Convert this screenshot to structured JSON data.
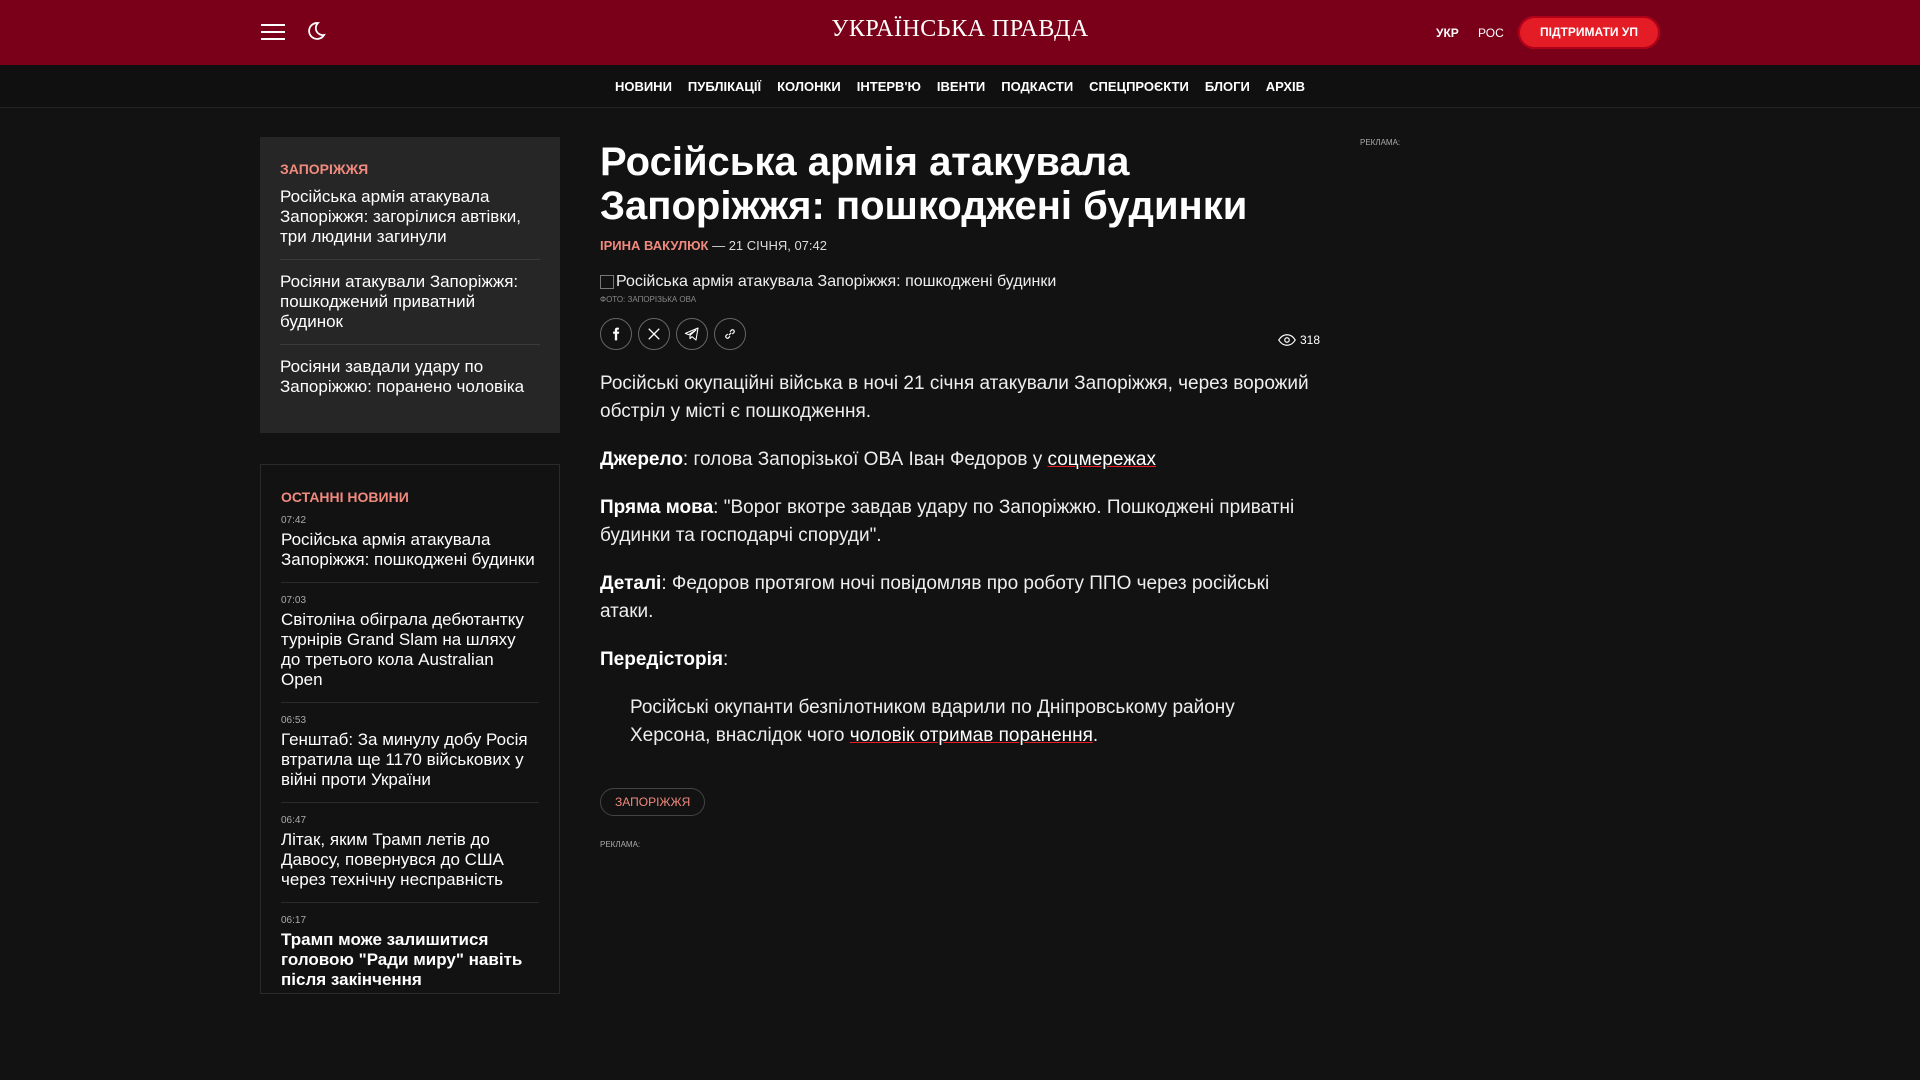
{
  "header": {
    "logo": "УКРАЇНСЬКА ПРАВДА",
    "lang_ukr": "УКР",
    "lang_ros": "РОС",
    "support_label": "ПІДТРИМАТИ УП"
  },
  "nav": [
    "НОВИНИ",
    "ПУБЛІКАЦІЇ",
    "КОЛОНКИ",
    "ІНТЕРВ'Ю",
    "ІВЕНТИ",
    "ПОДКАСТИ",
    "СПЕЦПРОЄКТИ",
    "БЛОГИ",
    "АРХІВ"
  ],
  "sidebar_related": {
    "title": "ЗАПОРІЖЖЯ",
    "items": [
      "Російська армія атакувала Запоріжжя: загорілися автівки, три людини загинули",
      "Росіяни атакували Запоріжжя: пошкоджений приватний будинок",
      "Росіяни завдали удару по Запоріжжю: поранено чоловіка"
    ]
  },
  "sidebar_latest": {
    "title": "ОСТАННІ НОВИНИ",
    "items": [
      {
        "time": "07:42",
        "title": "Російська армія атакувала Запоріжжя: пошкоджені будинки"
      },
      {
        "time": "07:03",
        "title": "Світоліна обіграла дебютантку турнірів Grand Slam на шляху до третього кола Australian Open"
      },
      {
        "time": "06:53",
        "title": "Генштаб: За минулу добу Росія втратила ще 1170 військових у війні проти України"
      },
      {
        "time": "06:47",
        "title": "Літак, яким Трамп летів до Давосу, повернувся до США через технічну несправність"
      },
      {
        "time": "06:17",
        "title": "Трамп може залишитися головою \"Ради миру\" навіть після закінчення"
      }
    ]
  },
  "article": {
    "title": "Російська армія атакувала Запоріжжя: пошкоджені будинки",
    "author": "ІРИНА ВАКУЛЮК",
    "date": "— 21 СІЧНЯ, 07:42",
    "image_alt": "Російська армія атакувала Запоріжжя: пошкоджені будинки",
    "photo_credit": "ФОТО: ЗАПОРІЗЬКА ОВА",
    "views": "318",
    "p1": "Російські окупаційні війська в ночі 21 січня атакували Запоріжжя, через ворожий обстріл у місті є пошкодження.",
    "source_label": "Джерело",
    "source_text": ": голова Запорізької ОВА Іван Федоров у ",
    "source_link": "соцмережах",
    "quote_label": "Пряма мова",
    "quote_text": ": \"Ворог вкотре завдав удару по Запоріжжю. Пошкоджені приватні будинки та господарчі споруди\".",
    "details_label": "Деталі",
    "details_text": ": Федоров протягом ночі повідомляв про роботу ППО через російські атаки.",
    "history_label": "Передісторія",
    "history_colon": ":",
    "history_text": "Російські окупанти безпілотником вдарили по Дніпровському району Херсона, внаслідок чого ",
    "history_link": "чоловік отримав поранення",
    "history_end": ".",
    "tag": "ЗАПОРІЖЖЯ",
    "ad_label": "РЕКЛАМА:"
  },
  "right_ad_label": "РЕКЛАМА:"
}
